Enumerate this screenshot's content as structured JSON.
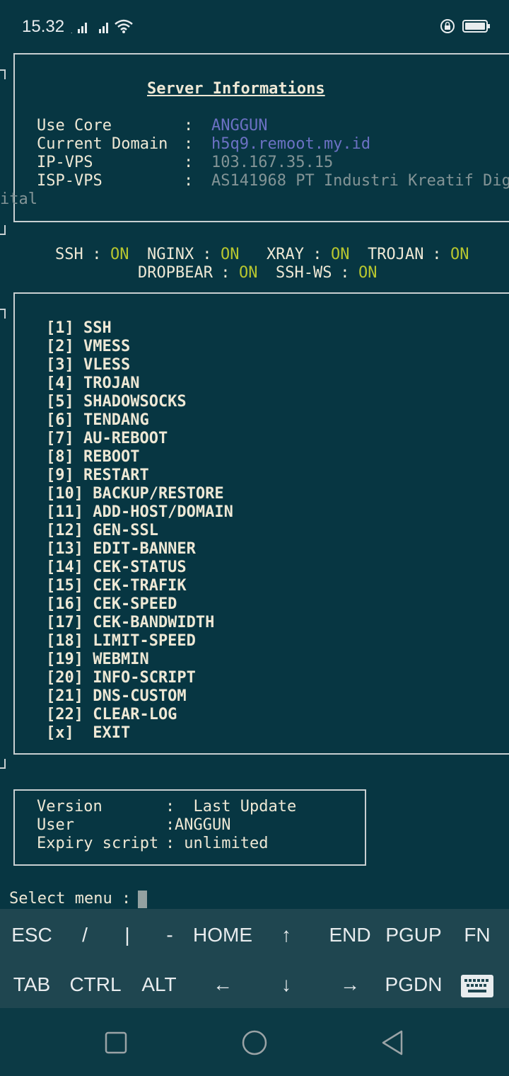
{
  "status_bar": {
    "time": "15.32",
    "icons": [
      "signal-icon",
      "signal-icon",
      "wifi-icon",
      "rotation-lock-icon",
      "battery-icon"
    ]
  },
  "server": {
    "title": "Server Informations",
    "rows": [
      {
        "label": "Use Core",
        "sep": ":",
        "value": "ANGGUN"
      },
      {
        "label": "Current Domain",
        "sep": ":",
        "value": "h5q9.remoot.my.id"
      },
      {
        "label": "IP-VPS",
        "sep": ":",
        "value": "103.167.35.15"
      },
      {
        "label": "ISP-VPS",
        "sep": ":",
        "value": "AS141968 PT Industri Kreatif Dig",
        "wrap": "ital"
      }
    ]
  },
  "services": {
    "row1": [
      {
        "name": "SSH",
        "sep": " : ",
        "state": "ON"
      },
      {
        "name": "NGINX",
        "sep": " : ",
        "state": "ON"
      },
      {
        "name": "XRAY",
        "sep": " : ",
        "state": "ON"
      },
      {
        "name": "TROJAN",
        "sep": " : ",
        "state": "ON"
      }
    ],
    "row2": [
      {
        "name": "DROPBEAR",
        "sep": " : ",
        "state": "ON"
      },
      {
        "name": "SSH-WS",
        "sep": " : ",
        "state": "ON"
      }
    ]
  },
  "menu": [
    "[1] SSH",
    "[2] VMESS",
    "[3] VLESS",
    "[4] TROJAN",
    "[5] SHADOWSOCKS",
    "[6] TENDANG",
    "[7] AU-REBOOT",
    "[8] REBOOT",
    "[9] RESTART",
    "[10] BACKUP/RESTORE",
    "[11] ADD-HOST/DOMAIN",
    "[12] GEN-SSL",
    "[13] EDIT-BANNER",
    "[14] CEK-STATUS",
    "[15] CEK-TRAFIK",
    "[16] CEK-SPEED",
    "[17] CEK-BANDWIDTH",
    "[18] LIMIT-SPEED",
    "[19] WEBMIN",
    "[20] INFO-SCRIPT",
    "[21] DNS-CUSTOM",
    "[22] CLEAR-LOG",
    "[x]  EXIT"
  ],
  "info": {
    "rows": [
      {
        "label": "Version       ",
        "sep": ":",
        "value": "  Last Update"
      },
      {
        "label": "User          ",
        "sep": ":",
        "value": "ANGGUN"
      },
      {
        "label": "Expiry script ",
        "sep": ":",
        "value": " unlimited"
      }
    ]
  },
  "prompt": "Select menu : ",
  "extra_keys": {
    "row1": [
      "ESC",
      "/",
      "|",
      "-",
      "HOME",
      "↑",
      "END",
      "PGUP",
      "FN"
    ],
    "row2": [
      "TAB",
      "CTRL",
      "ALT",
      "←",
      "↓",
      "→",
      "PGDN",
      "keyboard-icon"
    ]
  },
  "nav": [
    "square-icon",
    "circle-icon",
    "back-triangle-icon"
  ],
  "colors": {
    "background": "#073642",
    "value_blue": "#6c71c4",
    "value_grey": "#839496",
    "on_green": "#b7c62f"
  }
}
